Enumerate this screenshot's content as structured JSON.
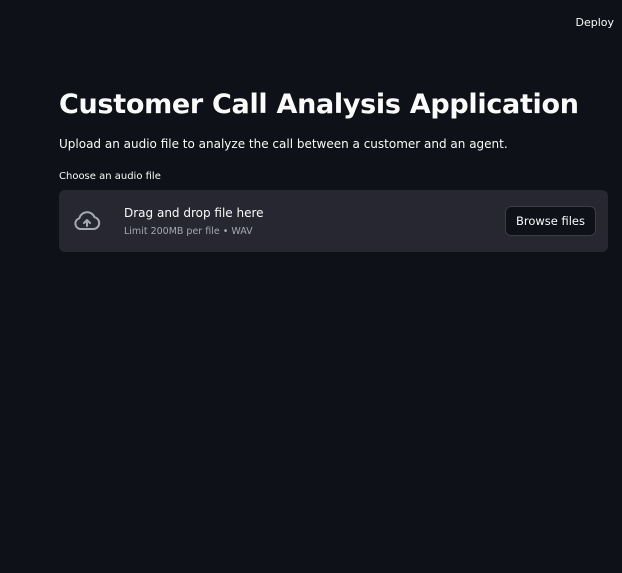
{
  "header": {
    "deploy_label": "Deploy"
  },
  "main": {
    "title": "Customer Call Analysis Application",
    "subtitle": "Upload an audio file to analyze the call between a customer and an agent."
  },
  "uploader": {
    "label": "Choose an audio file",
    "drag_text": "Drag and drop file here",
    "limit_text": "Limit 200MB per file • WAV",
    "browse_label": "Browse files",
    "icon": "cloud-upload-icon"
  },
  "colors": {
    "background": "#0e1117",
    "dropzone": "#262730",
    "text": "#fafafa",
    "muted_text": "#a3a8b4"
  }
}
